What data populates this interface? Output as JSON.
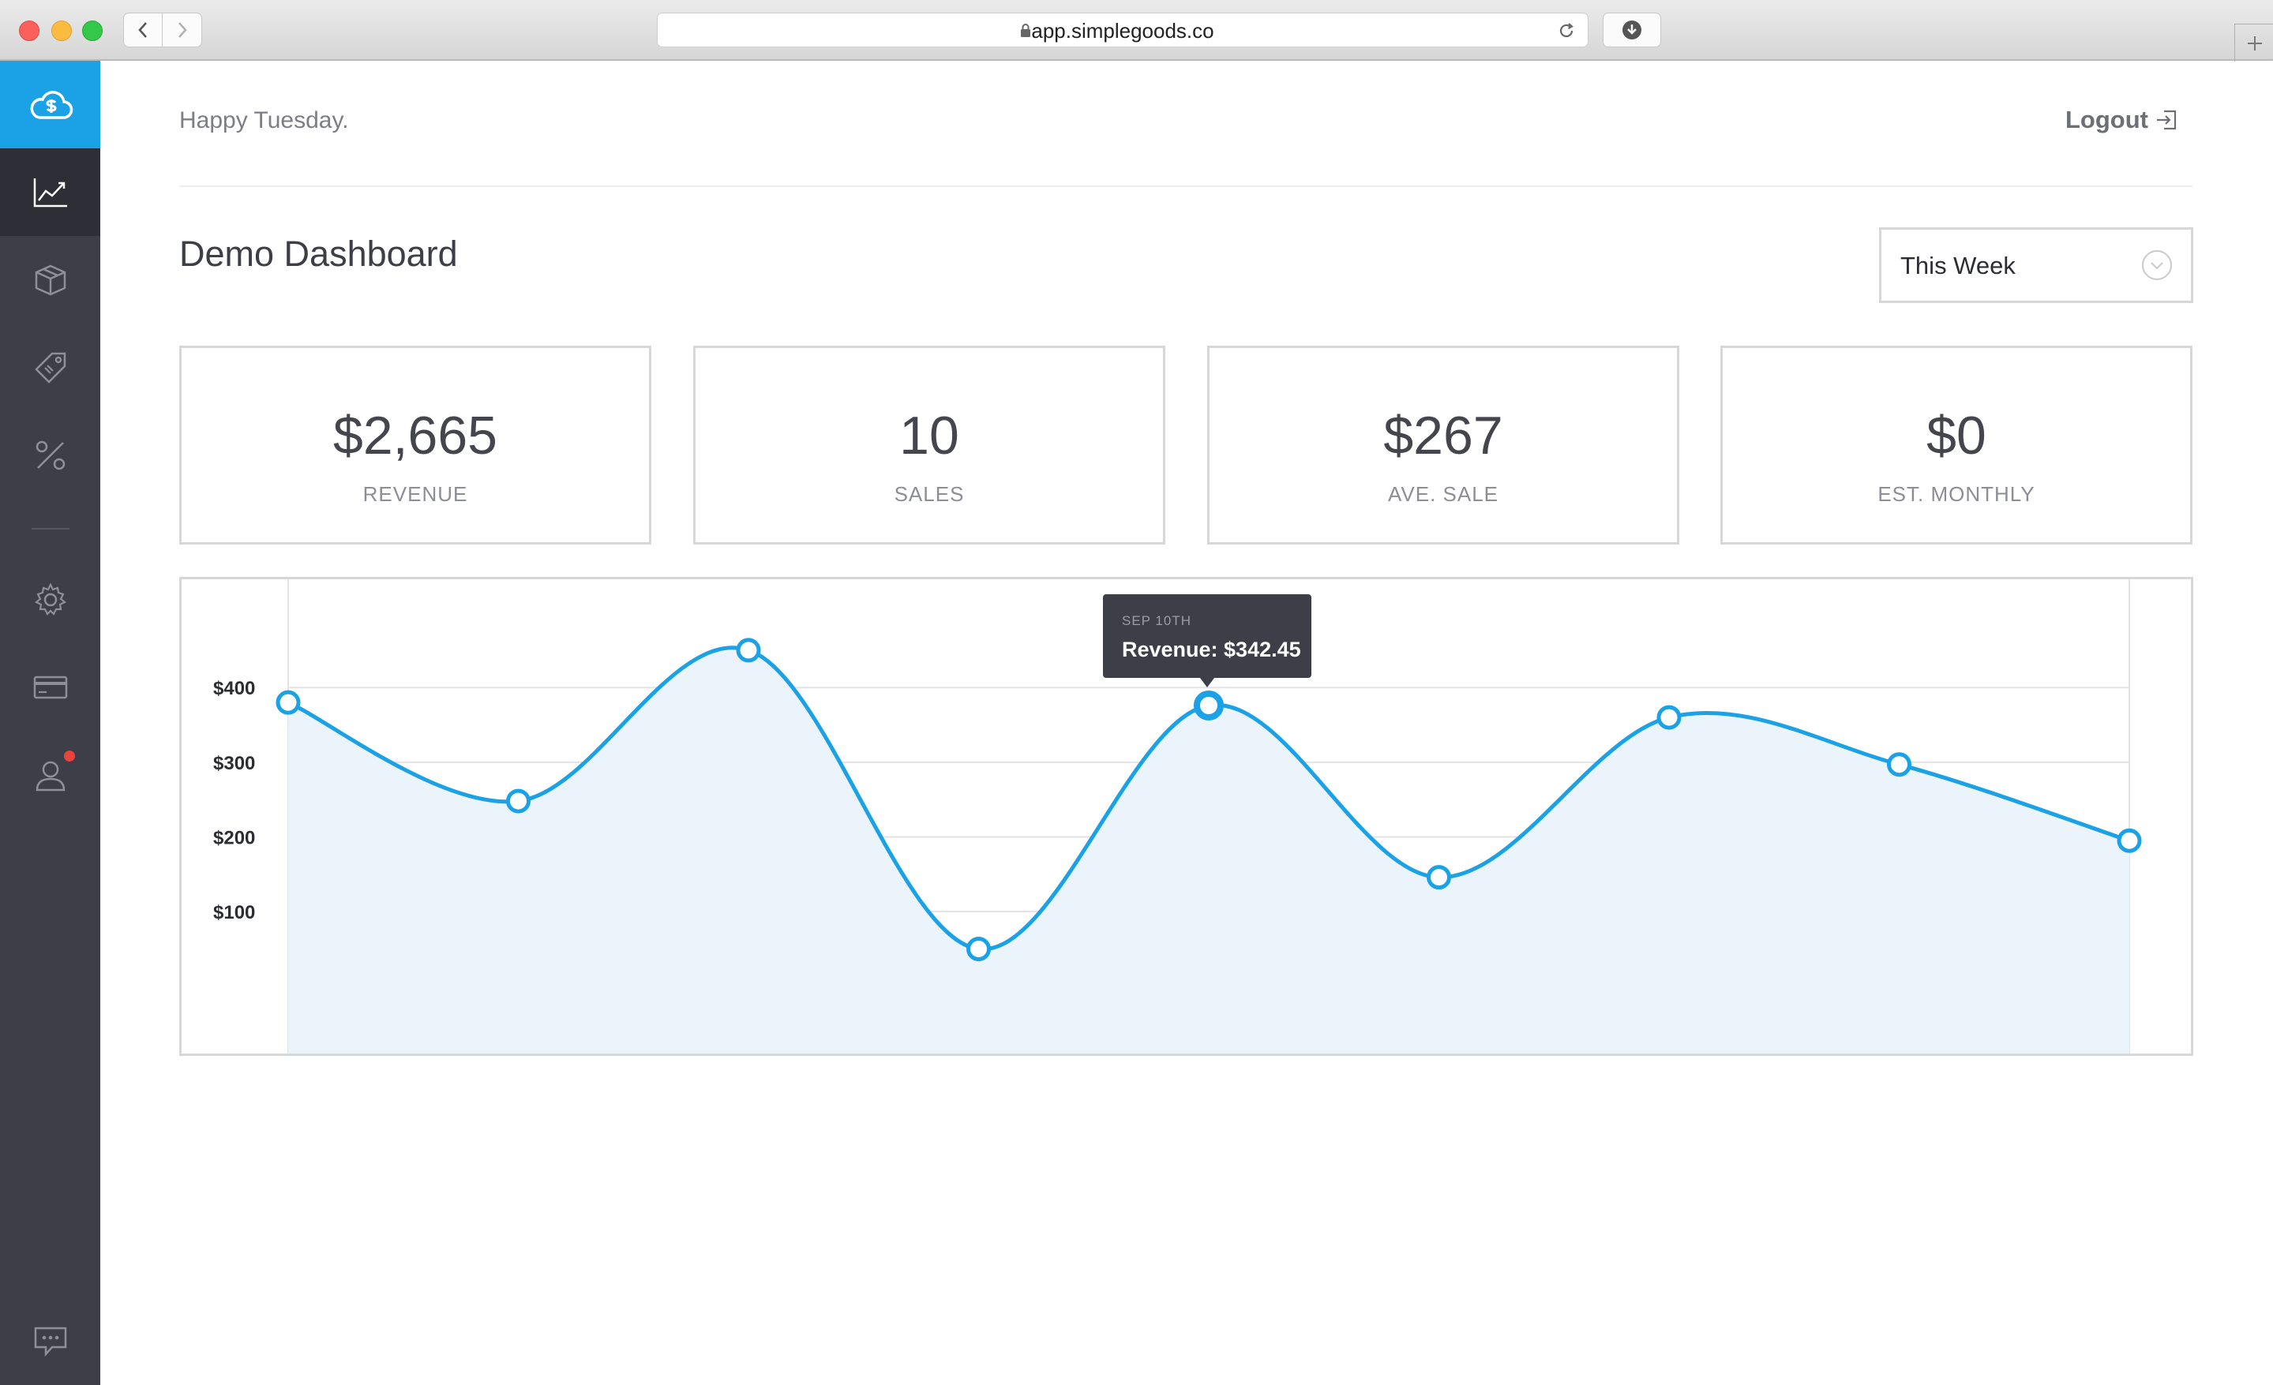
{
  "browser": {
    "url": "app.simplegoods.co",
    "icons": [
      "back-icon",
      "forward-icon",
      "lock-icon",
      "reload-icon",
      "download-icon",
      "new-tab-icon"
    ]
  },
  "sidebar": {
    "items": [
      {
        "name": "cloud-logo-icon",
        "active": false
      },
      {
        "name": "chart-icon",
        "active": true
      },
      {
        "name": "box-icon",
        "active": false
      },
      {
        "name": "tag-icon",
        "active": false
      },
      {
        "name": "percent-icon",
        "active": false
      },
      {
        "name": "gear-icon",
        "active": false
      },
      {
        "name": "credit-card-icon",
        "active": false
      },
      {
        "name": "user-icon",
        "active": false,
        "notification": true
      },
      {
        "name": "chat-icon",
        "active": false
      }
    ]
  },
  "header": {
    "greeting": "Happy Tuesday.",
    "logout_label": "Logout"
  },
  "main": {
    "title": "Demo Dashboard",
    "period": "This Week"
  },
  "stats": [
    {
      "value": "$2,665",
      "label": "REVENUE"
    },
    {
      "value": "10",
      "label": "SALES"
    },
    {
      "value": "$267",
      "label": "AVE. SALE"
    },
    {
      "value": "$0",
      "label": "EST. MONTHLY"
    }
  ],
  "tooltip": {
    "date": "SEP 10TH",
    "text": "Revenue: $342.45"
  },
  "colors": {
    "accent": "#1aa1e6",
    "sidebar": "#3d3e47",
    "area_fill": "#ebf3fb"
  },
  "chart_data": {
    "type": "area",
    "yticks": [
      100,
      200,
      300,
      400
    ],
    "ytick_labels": [
      "$100",
      "$200",
      "$300",
      "$400"
    ],
    "ylim": [
      -90,
      545
    ],
    "values": [
      380,
      248,
      450,
      50,
      376,
      146,
      360,
      297,
      195
    ],
    "highlight_index": 4,
    "series": [
      {
        "name": "Revenue",
        "values": [
          380,
          248,
          450,
          50,
          376,
          146,
          360,
          297,
          195
        ]
      }
    ]
  }
}
